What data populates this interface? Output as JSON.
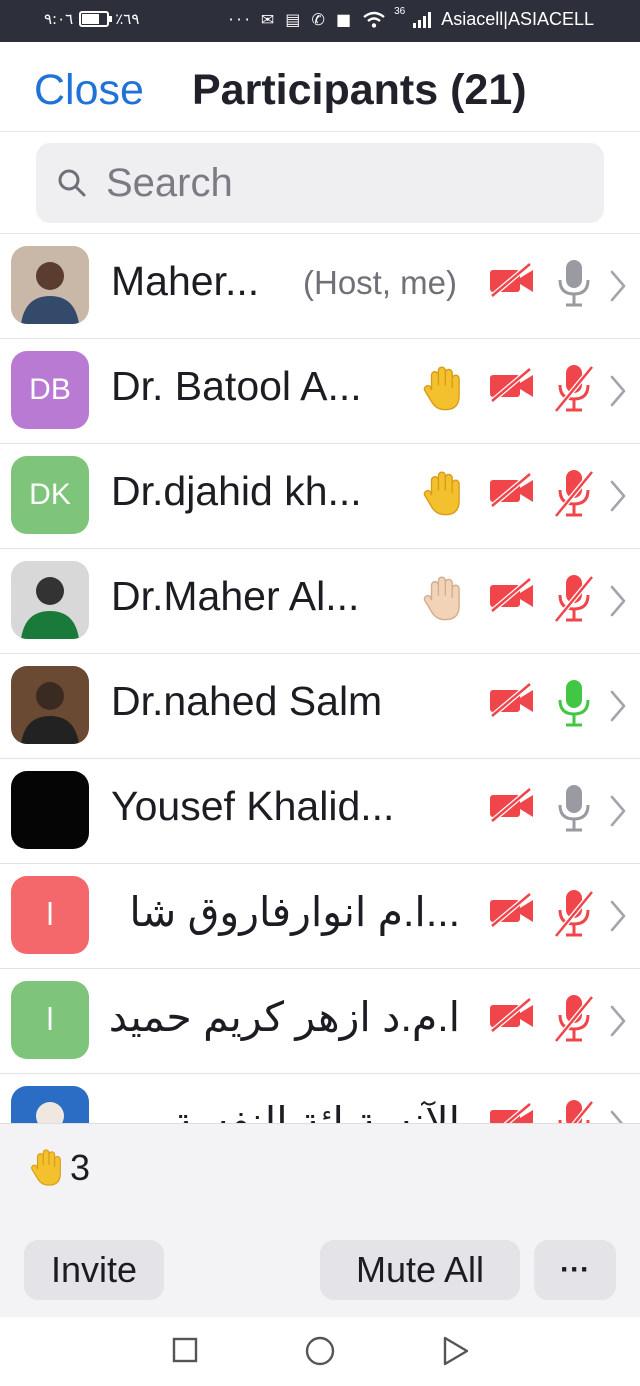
{
  "status_bar": {
    "time": "٩:٠٦",
    "battery": "٪٦٩",
    "battery_level": 0.69,
    "notification_icons": "··· ✉ ▤ ✆ ■",
    "network": "36",
    "carrier": "Asiacell|ASIACELL"
  },
  "header": {
    "close_label": "Close",
    "title": "Participants (21)"
  },
  "search": {
    "placeholder": "Search"
  },
  "participants": [
    {
      "name": "Maher...",
      "tag": "(Host, me)",
      "avatar_type": "photo",
      "hand": "none",
      "video": "off",
      "audio": "on"
    },
    {
      "name": "Dr. Batool A...",
      "avatar_initials": "DB",
      "avatar_color": "#b87ad3",
      "hand": "yellow",
      "video": "off",
      "audio": "muted"
    },
    {
      "name": "Dr.djahid kh...",
      "avatar_initials": "DK",
      "avatar_color": "#7ec47b",
      "hand": "yellow",
      "video": "off",
      "audio": "muted"
    },
    {
      "name": "Dr.Maher Al...",
      "avatar_type": "photo",
      "hand": "light",
      "video": "off",
      "audio": "muted"
    },
    {
      "name": "Dr.nahed Salm",
      "avatar_type": "photo",
      "hand": "none",
      "video": "off",
      "audio": "speaking"
    },
    {
      "name": "Yousef Khalid...",
      "avatar_type": "black",
      "hand": "none",
      "video": "off",
      "audio": "on"
    },
    {
      "name": "...ا.م انوارفاروق شا",
      "avatar_initials": "ا",
      "avatar_color": "#f4676a",
      "hand": "none",
      "video": "off",
      "audio": "muted"
    },
    {
      "name": "ا.م.د ازهر كريم حميد",
      "avatar_initials": "ا",
      "avatar_color": "#7ec47b",
      "hand": "none",
      "video": "off",
      "audio": "muted"
    },
    {
      "name": "الآنسة ائة النفسة",
      "avatar_type": "photo",
      "hand": "none",
      "video": "off",
      "audio": "muted"
    }
  ],
  "footer": {
    "raised_hands_count": "3",
    "invite_label": "Invite",
    "mute_all_label": "Mute All",
    "more_label": "···"
  },
  "colors": {
    "accent": "#1f73d6",
    "muted_red": "#f0464b",
    "speaking_green": "#43c643",
    "hand_yellow": "#f3c12e"
  }
}
